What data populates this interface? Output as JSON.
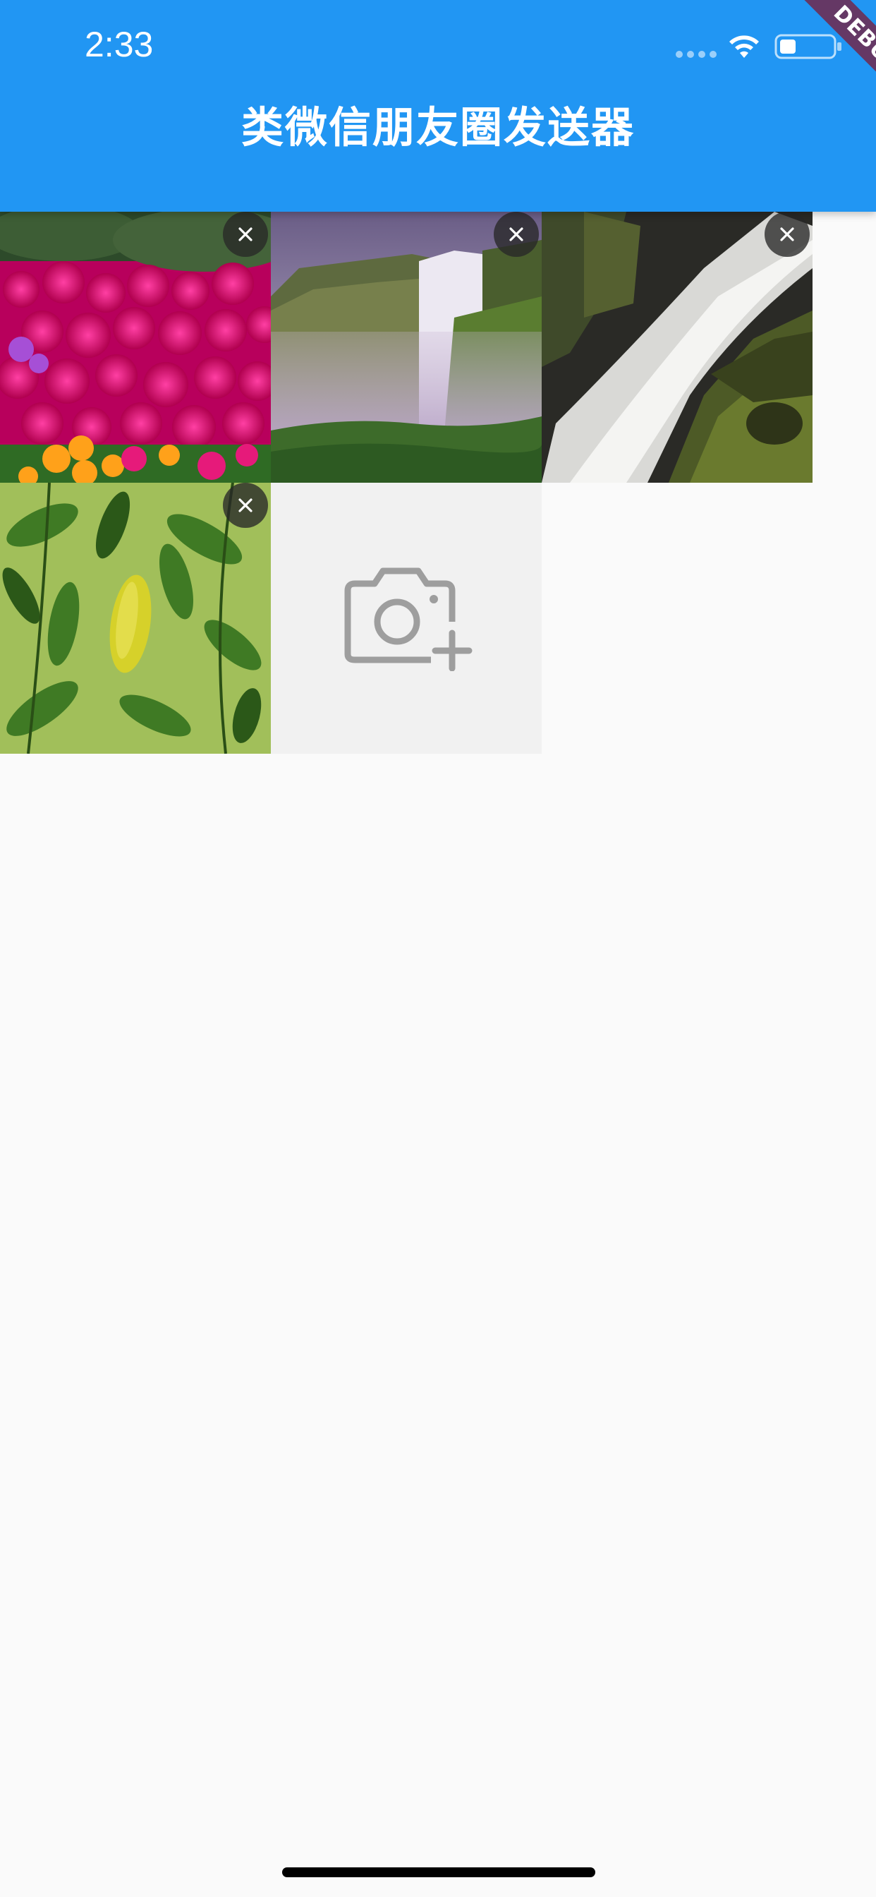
{
  "status_bar": {
    "time": "2:33"
  },
  "app_bar": {
    "title": "类微信朋友圈发送器",
    "background_color": "#2196f3"
  },
  "debug_banner": {
    "label": "DEBUG"
  },
  "photos": [
    {
      "subject": "pink-flowers",
      "remove_icon": "close-icon"
    },
    {
      "subject": "waterfall-valley",
      "remove_icon": "close-icon"
    },
    {
      "subject": "waterfall-rocks",
      "remove_icon": "close-icon"
    },
    {
      "subject": "green-leaves",
      "remove_icon": "close-icon"
    }
  ],
  "add_photo": {
    "icon": "camera-plus-icon"
  }
}
